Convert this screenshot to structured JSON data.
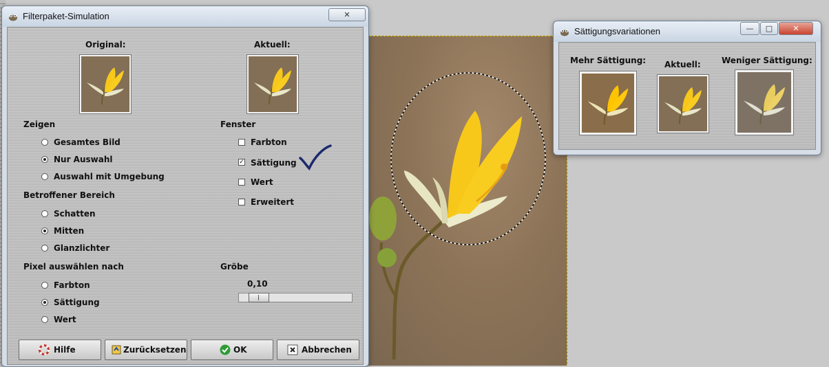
{
  "filter_window": {
    "title": "Filterpaket-Simulation",
    "original_label": "Original:",
    "aktuell_label": "Aktuell:",
    "zeigen_heading": "Zeigen",
    "zeigen_options": [
      "Gesamtes Bild",
      "Nur Auswahl",
      "Auswahl mit Umgebung"
    ],
    "zeigen_selected": "Nur Auswahl",
    "bereich_heading": "Betroffener Bereich",
    "bereich_options": [
      "Schatten",
      "Mitten",
      "Glanzlichter"
    ],
    "bereich_selected": "Mitten",
    "pixel_heading": "Pixel auswählen nach",
    "pixel_options": [
      "Farbton",
      "Sättigung",
      "Wert"
    ],
    "pixel_selected": "Sättigung",
    "fenster_heading": "Fenster",
    "fenster_options": [
      "Farbton",
      "Sättigung",
      "Wert",
      "Erweitert"
    ],
    "fenster_checked": [
      "Sättigung"
    ],
    "grobe_heading": "Gröbe",
    "grobe_value": "0,10",
    "grobe_fraction": 0.1,
    "buttons": {
      "help": "Hilfe",
      "reset": "Zurücksetzen",
      "ok": "OK",
      "cancel": "Abbrechen"
    },
    "close_label": "✕"
  },
  "sat_window": {
    "title": "Sättigungsvariationen",
    "more_label": "Mehr Sättigung:",
    "current_label": "Aktuell:",
    "less_label": "Weniger Sättigung:",
    "min_label": "—",
    "max_label": "□",
    "close_label": "✕"
  },
  "colors": {
    "window_bg": "#d6dde6",
    "client_bg": "#c0c0c0",
    "flower_yellow": "#f7c81a",
    "check_mark": "#1c2a6e",
    "selection_border": "#d9c200"
  }
}
